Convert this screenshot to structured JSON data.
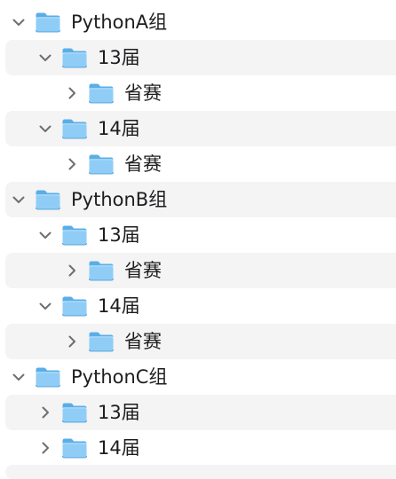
{
  "tree": {
    "rows": [
      {
        "label": "PythonA组",
        "level": 0,
        "expanded": true,
        "striped": false,
        "icon": "folder-icon"
      },
      {
        "label": "13届",
        "level": 1,
        "expanded": true,
        "striped": true,
        "icon": "folder-icon"
      },
      {
        "label": "省赛",
        "level": 2,
        "expanded": false,
        "striped": false,
        "icon": "folder-icon"
      },
      {
        "label": "14届",
        "level": 1,
        "expanded": true,
        "striped": true,
        "icon": "folder-icon"
      },
      {
        "label": "省赛",
        "level": 2,
        "expanded": false,
        "striped": false,
        "icon": "folder-icon"
      },
      {
        "label": "PythonB组",
        "level": 0,
        "expanded": true,
        "striped": true,
        "icon": "folder-icon"
      },
      {
        "label": "13届",
        "level": 1,
        "expanded": true,
        "striped": false,
        "icon": "folder-icon"
      },
      {
        "label": "省赛",
        "level": 2,
        "expanded": false,
        "striped": true,
        "icon": "folder-icon"
      },
      {
        "label": "14届",
        "level": 1,
        "expanded": true,
        "striped": false,
        "icon": "folder-icon"
      },
      {
        "label": "省赛",
        "level": 2,
        "expanded": false,
        "striped": true,
        "icon": "folder-icon"
      },
      {
        "label": "PythonC组",
        "level": 0,
        "expanded": true,
        "striped": false,
        "icon": "folder-icon"
      },
      {
        "label": "13届",
        "level": 1,
        "expanded": false,
        "striped": true,
        "icon": "folder-icon"
      },
      {
        "label": "14届",
        "level": 1,
        "expanded": false,
        "striped": false,
        "icon": "folder-icon"
      }
    ]
  },
  "colors": {
    "stripe": "#f4f4f5",
    "text": "#1d1d1f",
    "chevron": "#6e6e73",
    "folder_back": "#5aaee8",
    "folder_front": "#8fcdf7",
    "folder_edge": "#3d94d4"
  }
}
